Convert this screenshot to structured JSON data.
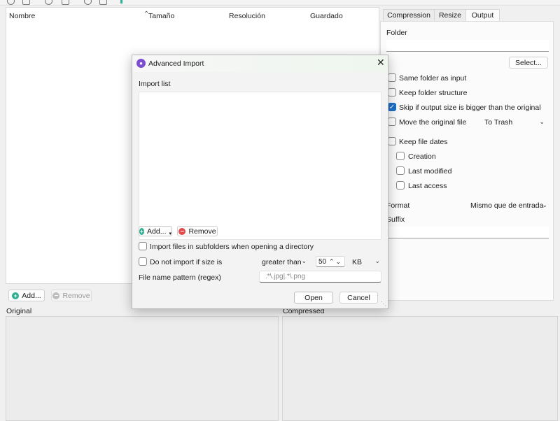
{
  "table": {
    "columns": [
      "Nombre",
      "Tamaño",
      "Resolución",
      "Guardado"
    ]
  },
  "bottom_buttons": {
    "add_label": "Add...",
    "remove_label": "Remove"
  },
  "panes": {
    "original_label": "Original",
    "compressed_label": "Compressed"
  },
  "settings": {
    "tabs": [
      "Compression",
      "Resize",
      "Output"
    ],
    "active_tab": "Output",
    "folder_label": "Folder",
    "folder_value": "",
    "select_button": "Select...",
    "same_folder": {
      "label": "Same folder as input",
      "checked": false
    },
    "keep_structure": {
      "label": "Keep folder structure",
      "checked": false
    },
    "skip_bigger": {
      "label": "Skip if output size is bigger than the original",
      "checked": true
    },
    "move_original": {
      "label": "Move the original file",
      "checked": false,
      "option": "To Trash"
    },
    "keep_dates": {
      "label": "Keep file dates",
      "checked": false
    },
    "creation": {
      "label": "Creation",
      "checked": false
    },
    "last_modified": {
      "label": "Last modified",
      "checked": false
    },
    "last_access": {
      "label": "Last access",
      "checked": false
    },
    "format_label": "Format",
    "format_value": "Mismo que de entrada",
    "suffix_label": "Suffix",
    "suffix_value": ""
  },
  "dialog": {
    "title": "Advanced Import",
    "close_icon": "close-icon",
    "import_list_label": "Import list",
    "add_label": "Add...",
    "remove_label": "Remove",
    "subfolders": {
      "label": "Import files in subfolders when opening a directory",
      "checked": false
    },
    "size_filter": {
      "label": "Do not import if size is",
      "checked": false,
      "comparator": "greater than",
      "value": "50",
      "unit": "KB"
    },
    "pattern_label": "File name pattern (regex)",
    "pattern_placeholder": ".*\\.jpg|.*\\.png",
    "open_button": "Open",
    "cancel_button": "Cancel"
  },
  "colors": {
    "accent": "#1f6fc8",
    "add_icon": "#2bae8f",
    "remove_icon": "#e04b4b",
    "app_icon": "#7d4fd0"
  }
}
